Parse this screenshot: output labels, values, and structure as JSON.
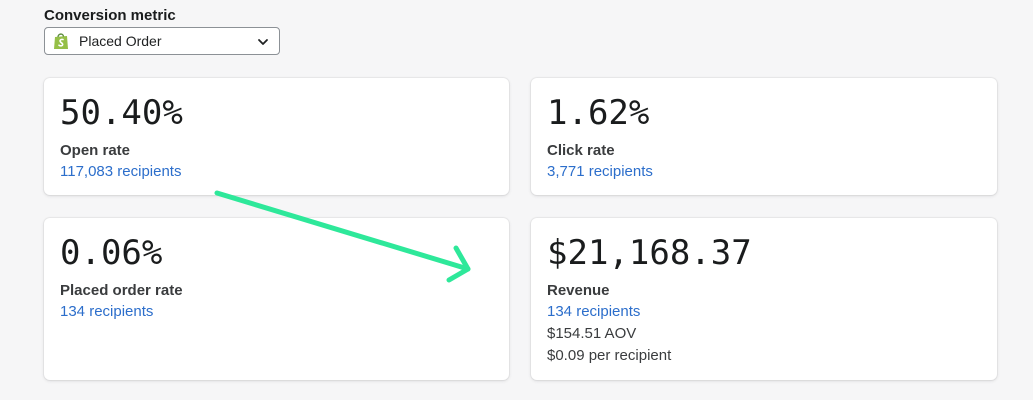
{
  "conversion": {
    "label": "Conversion metric",
    "selected": "Placed Order",
    "icon": "shopify-bag-icon"
  },
  "cards": {
    "open_rate": {
      "value": "50.40%",
      "title": "Open rate",
      "recipients": "117,083 recipients"
    },
    "click_rate": {
      "value": "1.62%",
      "title": "Click rate",
      "recipients": "3,771 recipients"
    },
    "placed_order_rate": {
      "value": "0.06%",
      "title": "Placed order rate",
      "recipients": "134 recipients"
    },
    "revenue": {
      "value": "$21,168.37",
      "title": "Revenue",
      "recipients": "134 recipients",
      "aov": "$154.51 AOV",
      "per_recipient": "$0.09 per recipient"
    }
  },
  "colors": {
    "link": "#2c6ecb",
    "arrow": "#2ee89a",
    "shopify_green": "#95bf47"
  }
}
